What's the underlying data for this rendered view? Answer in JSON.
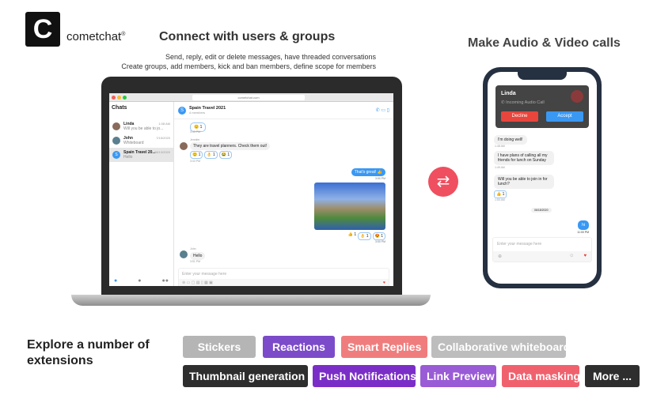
{
  "brand": {
    "logo_letter": "C",
    "name": "cometchat",
    "reg": "®"
  },
  "headline": "Connect with users & groups",
  "sub1": "Send, reply, edit or delete messages, have threaded conversations",
  "sub2": "Create groups, add members, kick and ban members, define scope for members",
  "calls_headline": "Make Audio & Video calls",
  "desktop": {
    "url": "cometchat.com",
    "sidebar_title": "Chats",
    "chats": [
      {
        "name": "Linda",
        "preview": "Will you be able to jo...",
        "time": "1:08 AM"
      },
      {
        "name": "John",
        "preview": "Whiteboard",
        "time": "7/15/2020"
      },
      {
        "name": "Spain Travel 20...",
        "preview": "Hello",
        "time": "08/13/2020",
        "initial": "S"
      }
    ],
    "group": {
      "name": "Spain Travel 2021",
      "members": "4 members",
      "initial": "S"
    },
    "messages": [
      {
        "reaction": "😊 1",
        "time": "3:43 PM"
      },
      {
        "sender": "Jennifer",
        "text": "They are travel planners. Check them out!",
        "reactions": [
          "😊 1",
          "👌 1",
          "😂 1"
        ],
        "time": "3:43 PM"
      },
      {
        "text": "That's great! 👍",
        "time": "3:50 PM",
        "out": true
      },
      {
        "reactions": [
          "👍 1",
          "👌 1",
          "😍 1"
        ],
        "time": "3:50 PM",
        "image": true
      },
      {
        "sender": "John",
        "text": "Hello",
        "time": "3:51 PM"
      }
    ],
    "composer_placeholder": "Enter your message here"
  },
  "phone": {
    "caller": "Linda",
    "call_type": "Incoming Audio Call",
    "decline": "Decline",
    "accept": "Accept",
    "messages": [
      {
        "text": "I'm doing well!",
        "time": "1:48 AM"
      },
      {
        "text": "I have plans of calling all my friends for lunch on Sunday",
        "time": "1:49 AM"
      },
      {
        "text": "Will you be able to join in for lunch?",
        "time": "1:50 AM",
        "reaction": "👍 1"
      }
    ],
    "date": "06/18/2020",
    "out_message": {
      "text": "hi",
      "time": "11:00 PM"
    },
    "composer_placeholder": "Enter your message here"
  },
  "extensions_title": "Explore a number of extensions",
  "extensions": [
    {
      "label": "Stickers",
      "color": "#b5b5b5"
    },
    {
      "label": "Reactions",
      "color": "#7c4bc9"
    },
    {
      "label": "Smart Replies",
      "color": "#f07d7d"
    },
    {
      "label": "Collaborative whiteboard",
      "color": "#bdbdbd"
    },
    {
      "label": "Thumbnail generation",
      "color": "#2e2e2e"
    },
    {
      "label": "Push Notifications",
      "color": "#7b2ec7"
    },
    {
      "label": "Link Preview",
      "color": "#9a5bd6"
    },
    {
      "label": "Data masking",
      "color": "#f0616e"
    },
    {
      "label": "More ...",
      "color": "#2e2e2e"
    }
  ],
  "colors": {
    "accent_blue": "#3a98f3",
    "swap": "#ef4f5f",
    "decline": "#e8453c"
  }
}
